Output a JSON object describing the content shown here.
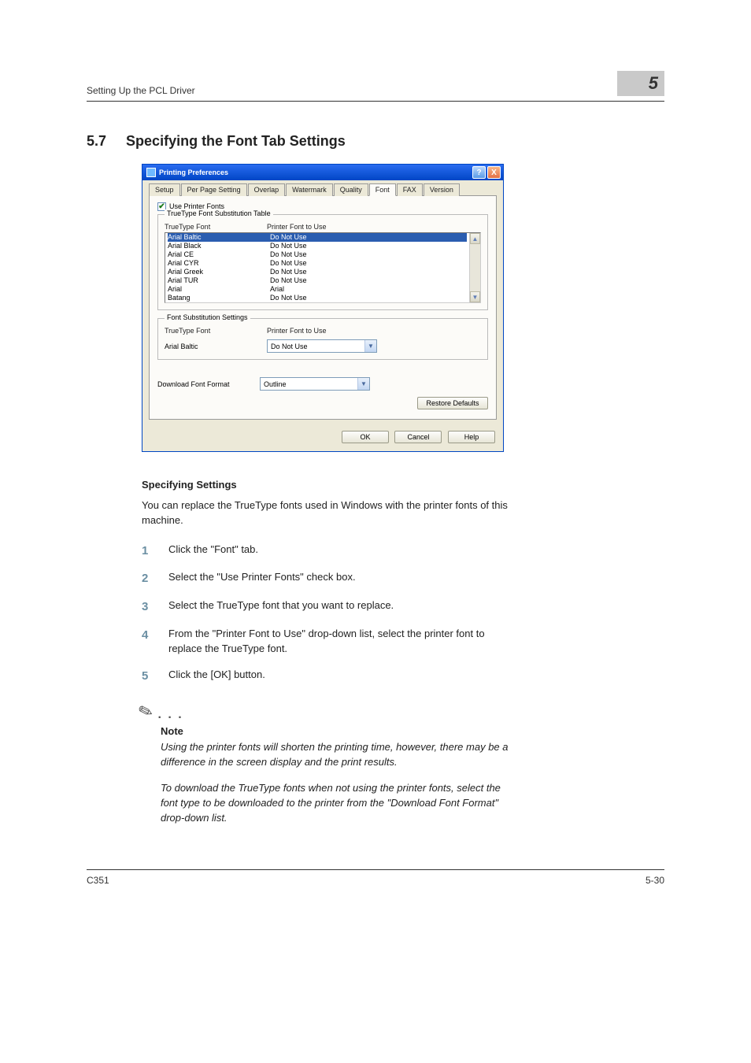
{
  "header": {
    "left": "Setting Up the PCL Driver",
    "right": "5"
  },
  "section": {
    "number": "5.7",
    "title": "Specifying the Font Tab Settings"
  },
  "dialog": {
    "title": "Printing Preferences",
    "help_glyph": "?",
    "close_glyph": "X",
    "tabs": [
      "Setup",
      "Per Page Setting",
      "Overlap",
      "Watermark",
      "Quality",
      "Font",
      "FAX",
      "Version"
    ],
    "active_tab_index": 5,
    "use_printer_fonts": {
      "label": "Use Printer Fonts",
      "checked": true
    },
    "substitution_table": {
      "legend": "TrueType Font Substitution Table",
      "col1": "TrueType Font",
      "col2": "Printer Font to Use",
      "rows": [
        {
          "tt": "Arial Baltic",
          "pf": "Do Not Use",
          "selected": true
        },
        {
          "tt": "Arial Black",
          "pf": "Do Not Use"
        },
        {
          "tt": "Arial CE",
          "pf": "Do Not Use"
        },
        {
          "tt": "Arial CYR",
          "pf": "Do Not Use"
        },
        {
          "tt": "Arial Greek",
          "pf": "Do Not Use"
        },
        {
          "tt": "Arial TUR",
          "pf": "Do Not Use"
        },
        {
          "tt": "Arial",
          "pf": "Arial"
        },
        {
          "tt": "Batang",
          "pf": "Do Not Use"
        }
      ]
    },
    "substitution_settings": {
      "legend": "Font Substitution Settings",
      "label_tt": "TrueType Font",
      "label_pf": "Printer Font to Use",
      "value_tt": "Arial Baltic",
      "value_pf": "Do Not Use"
    },
    "download_format": {
      "label": "Download Font Format",
      "value": "Outline"
    },
    "scroll_up": "▲",
    "scroll_down": "▼",
    "dropdown_arrow": "▼",
    "buttons": {
      "restore": "Restore Defaults",
      "ok": "OK",
      "cancel": "Cancel",
      "help": "Help"
    }
  },
  "doc": {
    "subhead": "Specifying Settings",
    "intro": "You can replace the TrueType fonts used in Windows with the printer fonts of this machine.",
    "steps": [
      "Click the \"Font\" tab.",
      "Select the \"Use Printer Fonts\" check box.",
      "Select the TrueType font that you want to replace.",
      "From the \"Printer Font to Use\" drop-down list, select the printer font to replace the TrueType font.",
      "Click the [OK] button."
    ],
    "note_label": "Note",
    "note1": "Using the printer fonts will shorten the printing time, however, there may be a difference in the screen display and the print results.",
    "note2": "To download the TrueType fonts when not using the printer fonts, select the font type to be downloaded to the printer from the \"Download Font Format\" drop-down list."
  },
  "footer": {
    "left": "C351",
    "right": "5-30"
  }
}
